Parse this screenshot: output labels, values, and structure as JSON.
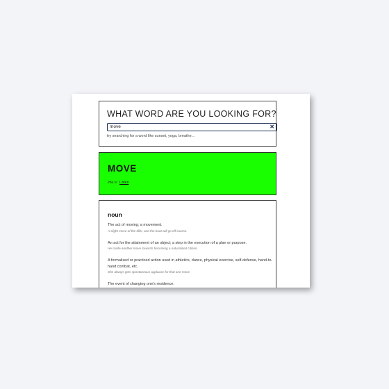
{
  "search": {
    "title": "WHAT WORD ARE YOU LOOKING FOR?",
    "value": "move",
    "clear_label": "✕",
    "hint": "try searching for a word like sunset, yoga, breathe..."
  },
  "word": {
    "headword": "MOVE",
    "phonetic": "/muːv/",
    "listen_label": "Listen",
    "accent_color": "#1aff00"
  },
  "definitions": {
    "part_of_speech": "noun",
    "items": [
      {
        "text": "The act of moving; a movement.",
        "example": "A slight move of the tiller, and the boat will go off course."
      },
      {
        "text": "An act for the attainment of an object; a step in the execution of a plan or purpose.",
        "example": "He made another move towards becoming a naturalized citizen."
      },
      {
        "text": "A formalized or practiced action used in athletics, dance, physical exercise, self-defense, hand-to-hand combat, etc.",
        "example": "She always gets spontaneous applause for that one move."
      },
      {
        "text": "The event of changing one's residence.",
        "example": ""
      }
    ]
  }
}
